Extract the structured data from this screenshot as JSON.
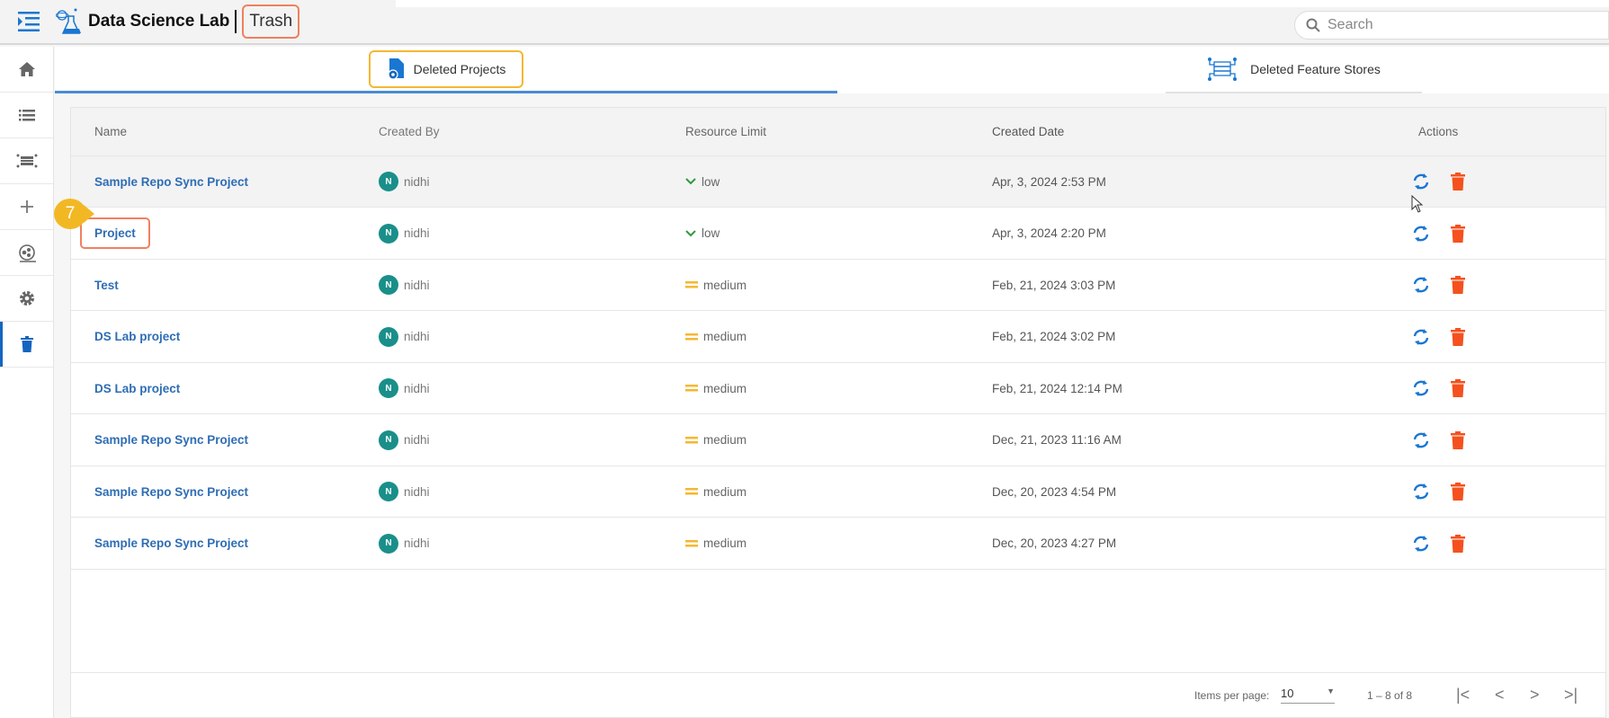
{
  "header": {
    "app_title": "Data Science Lab",
    "breadcrumb": "Trash",
    "search_placeholder": "Search"
  },
  "sidebar": {
    "items": [
      "home-icon",
      "list-icon",
      "feature-store-icon",
      "add-icon",
      "model-icon",
      "settings-icon",
      "trash-icon"
    ],
    "active": "trash-icon"
  },
  "tabs": [
    {
      "label": "Deleted Projects",
      "active": true
    },
    {
      "label": "Deleted Feature Stores",
      "active": false
    }
  ],
  "table": {
    "columns": [
      "Name",
      "Created By",
      "Resource Limit",
      "Created Date",
      "Actions"
    ],
    "rows": [
      {
        "name": "Sample Repo Sync Project",
        "initial": "N",
        "created_by": "nidhi",
        "resource": "low",
        "date": "Apr, 3, 2024 2:53 PM"
      },
      {
        "name": "Project",
        "initial": "N",
        "created_by": "nidhi",
        "resource": "low",
        "date": "Apr, 3, 2024 2:20 PM"
      },
      {
        "name": "Test",
        "initial": "N",
        "created_by": "nidhi",
        "resource": "medium",
        "date": "Feb, 21, 2024 3:03 PM"
      },
      {
        "name": "DS Lab project",
        "initial": "N",
        "created_by": "nidhi",
        "resource": "medium",
        "date": "Feb, 21, 2024 3:02 PM"
      },
      {
        "name": "DS Lab project",
        "initial": "N",
        "created_by": "nidhi",
        "resource": "medium",
        "date": "Feb, 21, 2024 12:14 PM"
      },
      {
        "name": "Sample Repo Sync Project",
        "initial": "N",
        "created_by": "nidhi",
        "resource": "medium",
        "date": "Dec, 21, 2023 11:16 AM"
      },
      {
        "name": "Sample Repo Sync Project",
        "initial": "N",
        "created_by": "nidhi",
        "resource": "medium",
        "date": "Dec, 20, 2023 4:54 PM"
      },
      {
        "name": "Sample Repo Sync Project",
        "initial": "N",
        "created_by": "nidhi",
        "resource": "medium",
        "date": "Dec, 20, 2023 4:27 PM"
      }
    ]
  },
  "pagination": {
    "items_per_page_label": "Items per page:",
    "items_per_page": "10",
    "range": "1 – 8 of 8"
  },
  "callout": {
    "step": "7"
  },
  "colors": {
    "accent": "#2e6db4",
    "low": "#2e9a3a",
    "medium": "#f5b731",
    "delete": "#f4511e",
    "highlight": "#f08060"
  }
}
